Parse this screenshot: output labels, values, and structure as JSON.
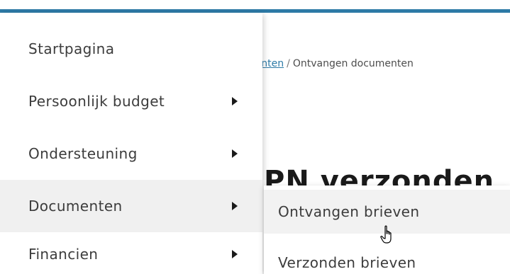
{
  "breadcrumb": {
    "parent_fragment": "menten",
    "separator": "/",
    "current": "Ontvangen documenten"
  },
  "heading_fragment": "PN verzonden",
  "menu": {
    "items": [
      {
        "label": "Startpagina",
        "has_submenu": false
      },
      {
        "label": "Persoonlijk budget",
        "has_submenu": true
      },
      {
        "label": "Ondersteuning",
        "has_submenu": true
      },
      {
        "label": "Documenten",
        "has_submenu": true,
        "active": true
      },
      {
        "label": "Financien",
        "has_submenu": true
      }
    ]
  },
  "submenu": {
    "items": [
      {
        "label": "Ontvangen brieven",
        "hover": true
      },
      {
        "label": "Verzonden brieven"
      }
    ]
  },
  "colors": {
    "accent": "#2d7aa6",
    "active_bg": "#f0f0f0"
  },
  "icons": {
    "arrow": "triangle-right-icon",
    "cursor": "hand-pointer-icon"
  }
}
